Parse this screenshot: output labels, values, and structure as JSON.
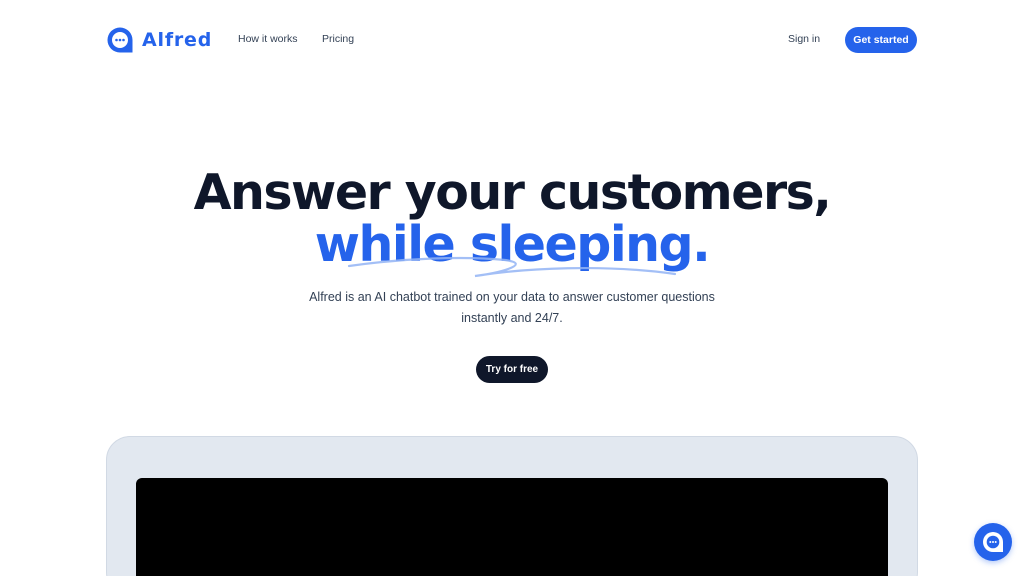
{
  "brand": {
    "name": "Alfred",
    "accent_color": "#2563eb",
    "dark_color": "#0f172a",
    "logo_icon": "chat-bubble-icon"
  },
  "nav": {
    "items": [
      {
        "label": "How it works"
      },
      {
        "label": "Pricing"
      }
    ],
    "sign_in": "Sign in",
    "cta": "Get started"
  },
  "hero": {
    "title_line1": "Answer your customers,",
    "title_line2": "while sleeping.",
    "subtitle": "Alfred is an AI chatbot trained on your data to answer customer questions instantly and 24/7.",
    "cta": "Try for free"
  },
  "chat_widget": {
    "icon": "chat-bubble-icon"
  }
}
